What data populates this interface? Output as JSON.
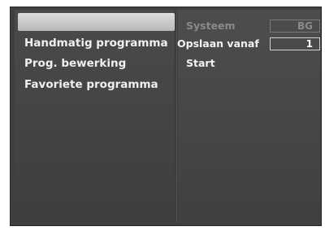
{
  "menu": {
    "items": [
      {
        "label": ""
      },
      {
        "label": "Handmatig programma"
      },
      {
        "label": "Prog. bewerking"
      },
      {
        "label": "Favoriete programma"
      }
    ]
  },
  "settings": {
    "rows": [
      {
        "label": "Systeem",
        "value": "BG"
      },
      {
        "label": "Opslaan vanaf",
        "value": "1"
      },
      {
        "label": "Start"
      }
    ]
  }
}
